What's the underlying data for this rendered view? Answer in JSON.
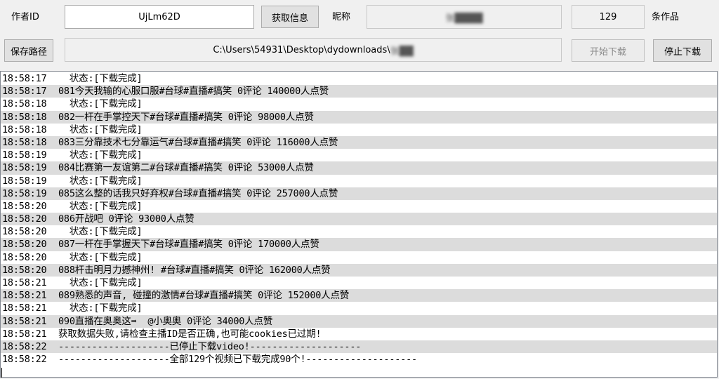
{
  "top": {
    "author_id_label": "作者ID",
    "author_id_value": "UjLm62D",
    "fetch_button": "获取信息",
    "nickname_label": "昵称",
    "nickname_value": "张████",
    "works_count": "129",
    "works_suffix": "条作品"
  },
  "path": {
    "save_button": "保存路径",
    "value": "C:\\Users\\54931\\Desktop\\dydownloads\\",
    "value_blurred": "张██",
    "start_button": "开始下载",
    "stop_button": "停止下载"
  },
  "log": [
    {
      "t": "18:58:17",
      "m": "  状态:[下载完成]"
    },
    {
      "t": "18:58:17",
      "m": "081今天我输的心服口服#台球#直播#搞笑 0评论 140000人点赞"
    },
    {
      "t": "18:58:18",
      "m": "  状态:[下载完成]"
    },
    {
      "t": "18:58:18",
      "m": "082一杆在手掌控天下#台球#直播#搞笑 0评论 98000人点赞"
    },
    {
      "t": "18:58:18",
      "m": "  状态:[下载完成]"
    },
    {
      "t": "18:58:18",
      "m": "083三分靠技术七分靠运气#台球#直播#搞笑 0评论 116000人点赞"
    },
    {
      "t": "18:58:19",
      "m": "  状态:[下载完成]"
    },
    {
      "t": "18:58:19",
      "m": "084比赛第一友谊第二#台球#直播#搞笑 0评论 53000人点赞"
    },
    {
      "t": "18:58:19",
      "m": "  状态:[下载完成]"
    },
    {
      "t": "18:58:19",
      "m": "085这么整的话我只好弃权#台球#直播#搞笑 0评论 257000人点赞"
    },
    {
      "t": "18:58:20",
      "m": "  状态:[下载完成]"
    },
    {
      "t": "18:58:20",
      "m": "086开战吧 0评论 93000人点赞"
    },
    {
      "t": "18:58:20",
      "m": "  状态:[下载完成]"
    },
    {
      "t": "18:58:20",
      "m": "087一杆在手掌握天下#台球#直播#搞笑 0评论 170000人点赞"
    },
    {
      "t": "18:58:20",
      "m": "  状态:[下载完成]"
    },
    {
      "t": "18:58:20",
      "m": "088杆击明月力撼神州! #台球#直播#搞笑 0评论 162000人点赞"
    },
    {
      "t": "18:58:21",
      "m": "  状态:[下载完成]"
    },
    {
      "t": "18:58:21",
      "m": "089熟悉的声音, 碰撞的激情#台球#直播#搞笑 0评论 152000人点赞"
    },
    {
      "t": "18:58:21",
      "m": "  状态:[下载完成]"
    },
    {
      "t": "18:58:21",
      "m": "090直播在奥奥这➡  @小奥奥 0评论 34000人点赞"
    },
    {
      "t": "18:58:21",
      "m": "获取数据失败,请检查主播ID是否正确,也可能cookies已过期!"
    },
    {
      "t": "18:58:22",
      "m": "--------------------已停止下载video!--------------------"
    },
    {
      "t": "18:58:22",
      "m": "--------------------全部129个视频已下载完成90个!--------------------"
    }
  ]
}
